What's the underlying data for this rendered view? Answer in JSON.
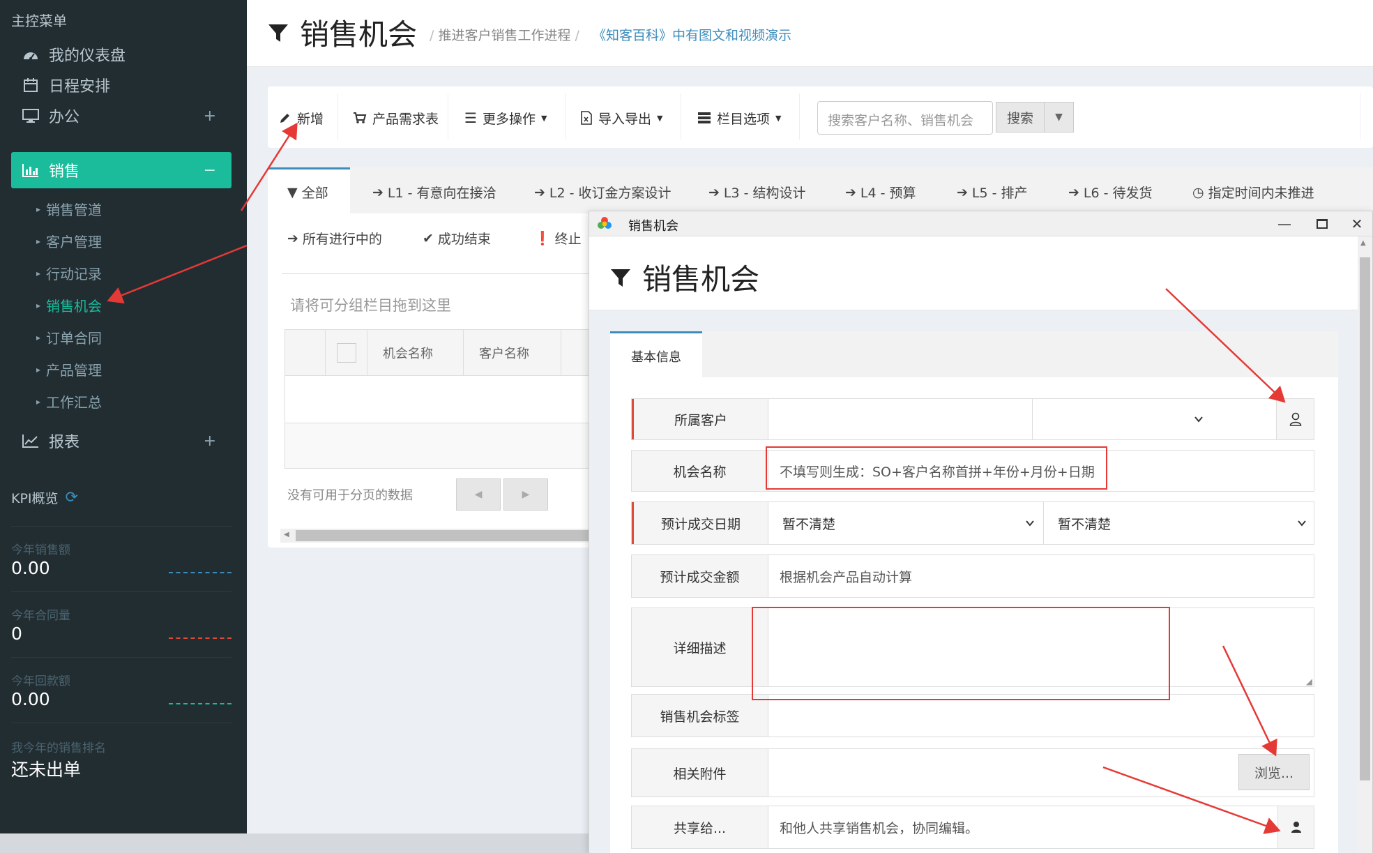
{
  "sidebar": {
    "menu_title": "主控菜单",
    "items": [
      {
        "label": "我的仪表盘"
      },
      {
        "label": "日程安排"
      },
      {
        "label": "办公",
        "expander": "+"
      },
      {
        "label": "销售",
        "expander": "−"
      },
      {
        "label": "报表",
        "expander": "+"
      }
    ],
    "sales_sub": [
      "销售管道",
      "客户管理",
      "行动记录",
      "销售机会",
      "订单合同",
      "产品管理",
      "工作汇总"
    ],
    "kpi": {
      "title": "KPI概览",
      "stats": [
        {
          "label": "今年销售额",
          "value": "0.00",
          "line_color": "#3c8dbc"
        },
        {
          "label": "今年合同量",
          "value": "0",
          "line_color": "#dd4b39"
        },
        {
          "label": "今年回款额",
          "value": "0.00",
          "line_color": "#1abc9c"
        }
      ],
      "rank_label": "我今年的销售排名",
      "rank_value": "还未出单"
    }
  },
  "header": {
    "title": "销售机会",
    "breadcrumb": "推进客户销售工作进程",
    "link": "《知客百科》中有图文和视频演示"
  },
  "toolbar": {
    "add": "新增",
    "product_req": "产品需求表",
    "more_ops": "更多操作",
    "import_export": "导入导出",
    "columns": "栏目选项",
    "search_placeholder": "搜索客户名称、销售机会",
    "search_btn": "搜索"
  },
  "tabs": [
    "全部",
    "L1 - 有意向在接洽",
    "L2 - 收订金方案设计",
    "L3 - 结构设计",
    "L4 - 预算",
    "L5 - 排产",
    "L6 - 待发货",
    "指定时间内未推进",
    "所有进行中的",
    "成功结束",
    "终止"
  ],
  "grid": {
    "group_hint": "请将可分组栏目拖到这里",
    "columns": [
      "机会名称",
      "客户名称"
    ],
    "no_data": "没有可用于分页的数据"
  },
  "modal": {
    "window_title": "销售机会",
    "title": "销售机会",
    "tab": "基本信息",
    "fields": {
      "customer": {
        "label": "所属客户"
      },
      "name": {
        "label": "机会名称",
        "placeholder": "不填写则生成：SO+客户名称首拼+年份+月份+日期"
      },
      "deal_date": {
        "label": "预计成交日期",
        "option1": "暂不清楚",
        "option2": "暂不清楚"
      },
      "amount": {
        "label": "预计成交金额",
        "placeholder": "根据机会产品自动计算"
      },
      "description": {
        "label": "详细描述"
      },
      "tags": {
        "label": "销售机会标签"
      },
      "attachment": {
        "label": "相关附件",
        "browse": "浏览..."
      },
      "share": {
        "label": "共享给...",
        "placeholder": "和他人共享销售机会，协同编辑。"
      }
    }
  },
  "colors": {
    "sidebar_bg": "#222d32",
    "accent": "#1abc9c",
    "link": "#3c8dbc",
    "annotation": "#e53935"
  }
}
